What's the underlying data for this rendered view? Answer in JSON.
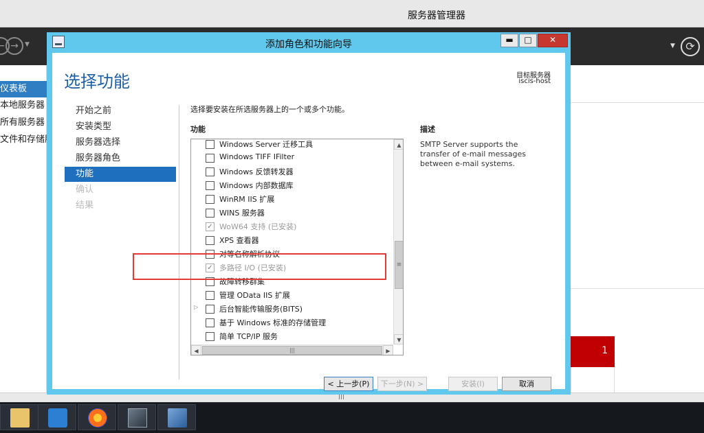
{
  "app": {
    "title": "服务器管理器",
    "sidebar": [
      {
        "label": "仪表板",
        "active": true
      },
      {
        "label": "本地服务器",
        "active": false
      },
      {
        "label": "所有服务器",
        "active": false
      },
      {
        "label": "文件和存储服务",
        "active": false
      }
    ],
    "tile_count": "1",
    "colors": {
      "toolbar": "#2b2b2b",
      "tile": "#c00000",
      "accent": "#2f7ec4"
    },
    "icons": {
      "back": "back-arrow-icon",
      "forward": "forward-arrow-icon",
      "refresh": "refresh-icon"
    }
  },
  "wizard": {
    "title": "添加角色和功能向导",
    "heading": "选择功能",
    "target_label": "目标服务器",
    "target_host": "iscis-host",
    "steps": [
      {
        "label": "开始之前",
        "state": "normal"
      },
      {
        "label": "安装类型",
        "state": "normal"
      },
      {
        "label": "服务器选择",
        "state": "normal"
      },
      {
        "label": "服务器角色",
        "state": "normal"
      },
      {
        "label": "功能",
        "state": "active"
      },
      {
        "label": "确认",
        "state": "disabled"
      },
      {
        "label": "结果",
        "state": "disabled"
      }
    ],
    "instruction": "选择要安装在所选服务器上的一个或多个功能。",
    "features_header": "功能",
    "description_header": "描述",
    "description": "SMTP Server supports the transfer of e-mail messages between e-mail systems.",
    "features": [
      {
        "label": "Windows Server 迁移工具",
        "checked": false,
        "installed": false,
        "expandable": false
      },
      {
        "label": "Windows TIFF IFilter",
        "checked": false,
        "installed": false,
        "expandable": false
      },
      {
        "label": "Windows 反馈转发器",
        "checked": false,
        "installed": false,
        "expandable": false
      },
      {
        "label": "Windows 内部数据库",
        "checked": false,
        "installed": false,
        "expandable": false
      },
      {
        "label": "WinRM IIS 扩展",
        "checked": false,
        "installed": false,
        "expandable": false
      },
      {
        "label": "WINS 服务器",
        "checked": false,
        "installed": false,
        "expandable": false
      },
      {
        "label": "WoW64 支持 (已安装)",
        "checked": true,
        "installed": true,
        "expandable": false
      },
      {
        "label": "XPS 查看器",
        "checked": false,
        "installed": false,
        "expandable": false
      },
      {
        "label": "对等名称解析协议",
        "checked": false,
        "installed": false,
        "expandable": false
      },
      {
        "label": "多路径 I/O (已安装)",
        "checked": true,
        "installed": true,
        "expandable": false
      },
      {
        "label": "故障转移群集",
        "checked": false,
        "installed": false,
        "expandable": false
      },
      {
        "label": "管理 OData IIS 扩展",
        "checked": false,
        "installed": false,
        "expandable": false
      },
      {
        "label": "后台智能传输服务(BITS)",
        "checked": false,
        "installed": false,
        "expandable": true
      },
      {
        "label": "基于 Windows 标准的存储管理",
        "checked": false,
        "installed": false,
        "expandable": false
      },
      {
        "label": "简单 TCP/IP 服务",
        "checked": false,
        "installed": false,
        "expandable": false
      }
    ],
    "buttons": {
      "prev": "< 上一步(P)",
      "next": "下一步(N) >",
      "install": "安装(I)",
      "cancel": "取消"
    },
    "colors": {
      "titlebar": "#5fc8ec",
      "heading": "#1f5fa8",
      "active_step": "#1e6fbd",
      "highlight": "#e53935"
    }
  }
}
